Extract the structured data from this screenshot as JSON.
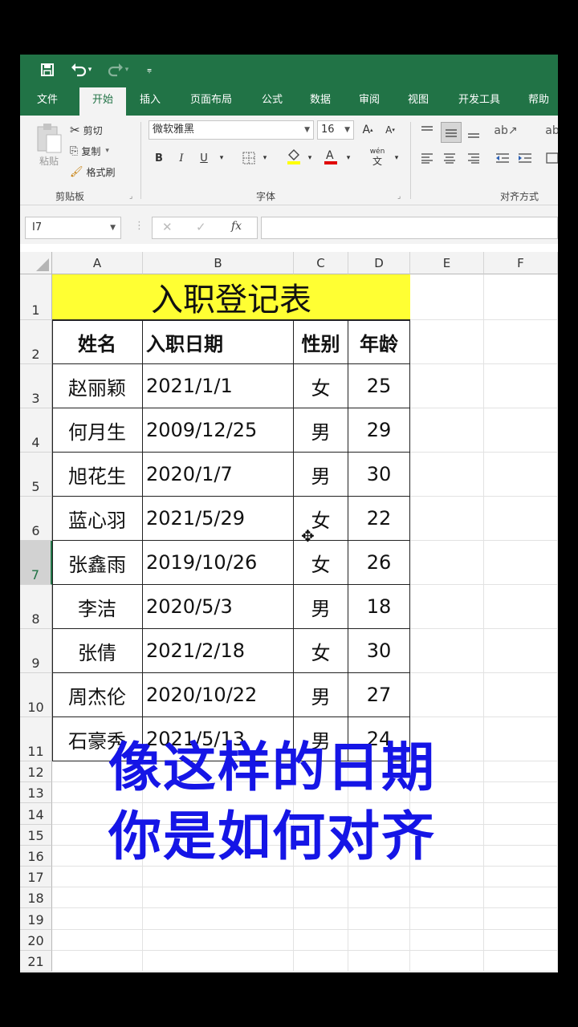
{
  "qat": {
    "save_icon": "save-icon",
    "undo_icon": "undo-icon",
    "redo_icon": "redo-icon",
    "customize_icon": "customize-icon"
  },
  "tabs": [
    "文件",
    "开始",
    "插入",
    "页面布局",
    "公式",
    "数据",
    "审阅",
    "视图",
    "开发工具",
    "帮助"
  ],
  "active_tab": "开始",
  "ribbon": {
    "clipboard": {
      "paste": "粘贴",
      "cut": "剪切",
      "copy": "复制",
      "format_painter": "格式刷",
      "label": "剪贴板"
    },
    "font": {
      "family": "微软雅黑",
      "size": "16",
      "bold": "B",
      "italic": "I",
      "underline": "U",
      "label": "字体",
      "phonetic_top": "wén",
      "phonetic_bottom": "文"
    },
    "alignment": {
      "label": "对齐方式"
    }
  },
  "formula_bar": {
    "name_box": "I7",
    "fx": "fx",
    "cancel": "✕",
    "enter": "✓",
    "formula": ""
  },
  "columns": [
    "A",
    "B",
    "C",
    "D",
    "E",
    "F"
  ],
  "rows": [
    "1",
    "2",
    "3",
    "4",
    "5",
    "6",
    "7",
    "8",
    "9",
    "10",
    "11",
    "12",
    "13",
    "14",
    "15",
    "16",
    "17",
    "18",
    "19",
    "20",
    "21"
  ],
  "selected_row": "7",
  "sheet": {
    "title": "入职登记表",
    "headers": [
      "姓名",
      "入职日期",
      "性别",
      "年龄"
    ],
    "records": [
      [
        "赵丽颖",
        "2021/1/1",
        "女",
        "25"
      ],
      [
        "何月生",
        "2009/12/25",
        "男",
        "29"
      ],
      [
        "旭花生",
        "2020/1/7",
        "男",
        "30"
      ],
      [
        "蓝心羽",
        "2021/5/29",
        "女",
        "22"
      ],
      [
        "张鑫雨",
        "2019/10/26",
        "女",
        "26"
      ],
      [
        "李洁",
        "2020/5/3",
        "男",
        "18"
      ],
      [
        "张倩",
        "2021/2/18",
        "女",
        "30"
      ],
      [
        "周杰伦",
        "2020/10/22",
        "男",
        "27"
      ],
      [
        "石豪秀",
        "2021/5/13",
        "男",
        "24"
      ]
    ]
  },
  "overlay": {
    "line1": "像这样的日期",
    "line2": "你是如何对齐",
    "color": "#1515e6"
  },
  "colors": {
    "excel_green": "#217346",
    "title_fill": "#ffff33"
  }
}
